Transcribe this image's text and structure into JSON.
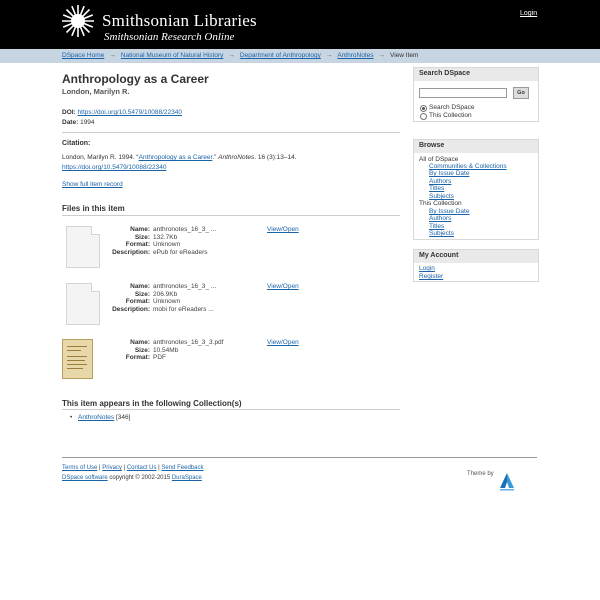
{
  "header": {
    "logo_main": "Smithsonian Libraries",
    "logo_sub": "Smithsonian Research Online",
    "login": "Login"
  },
  "breadcrumbs": [
    "DSpace Home",
    "National Museum of Natural History",
    "Department of Anthropology",
    "AnthroNotes",
    "View Item"
  ],
  "breadcrumb_sep": "→",
  "item": {
    "title": "Anthropology as a Career",
    "author": "London, Marilyn R.",
    "doi_label": "DOI:",
    "doi": "https://doi.org/10.5479/10088/22340",
    "date_label": "Date:",
    "date": "1994",
    "citation_label": "Citation:",
    "citation_pre": "London, Marilyn R. 1994. “",
    "citation_link": "Anthropology as a Career",
    "citation_mid": ".”",
    "citation_journal": "AnthroNotes",
    "citation_post": ". 16 (3):13–14.",
    "citation_doi": "https://doi.org/10.5479/10088/22340",
    "show_full": "Show full item record"
  },
  "files": {
    "heading": "Files in this item",
    "labels": {
      "name": "Name:",
      "size": "Size:",
      "format": "Format:",
      "description": "Description:"
    },
    "view_label": "View/Open",
    "list": [
      {
        "name": "anthronotes_16_3_ ...",
        "size": "132.7Kb",
        "format": "Unknown",
        "description": "ePub for eReaders"
      },
      {
        "name": "anthronotes_16_3_ ...",
        "size": "206.9Kb",
        "format": "Unknown",
        "description": "mobi for eReaders ..."
      },
      {
        "name": "anthronotes_16_3_3.pdf",
        "size": "10.54Mb",
        "format": "PDF"
      }
    ]
  },
  "collections": {
    "heading": "This item appears in the following Collection(s)",
    "item": "AnthroNotes",
    "count": "[346]"
  },
  "sidebar": {
    "search": {
      "heading": "Search DSpace",
      "go": "Go",
      "option_all": "Search DSpace",
      "option_collection": "This Collection"
    },
    "browse": {
      "heading": "Browse",
      "all_label": "All of DSpace",
      "all_items": [
        "Communities & Collections",
        "By Issue Date",
        "Authors",
        "Titles",
        "Subjects"
      ],
      "coll_label": "This Collection",
      "coll_items": [
        "By Issue Date",
        "Authors",
        "Titles",
        "Subjects"
      ]
    },
    "account": {
      "heading": "My Account",
      "login": "Login",
      "register": "Register"
    }
  },
  "footer": {
    "links": [
      "Terms of Use",
      "Privacy",
      "Contact Us",
      "Send Feedback"
    ],
    "dspace_software": "DSpace software",
    "copyright": " copyright © 2002-2015 ",
    "duraspace": "DuraSpace",
    "theme_by": "Theme by"
  },
  "colors": {
    "header_bg": "#000000",
    "breadcrumb_bg": "#c7d4e2",
    "link": "#1a63a8"
  }
}
